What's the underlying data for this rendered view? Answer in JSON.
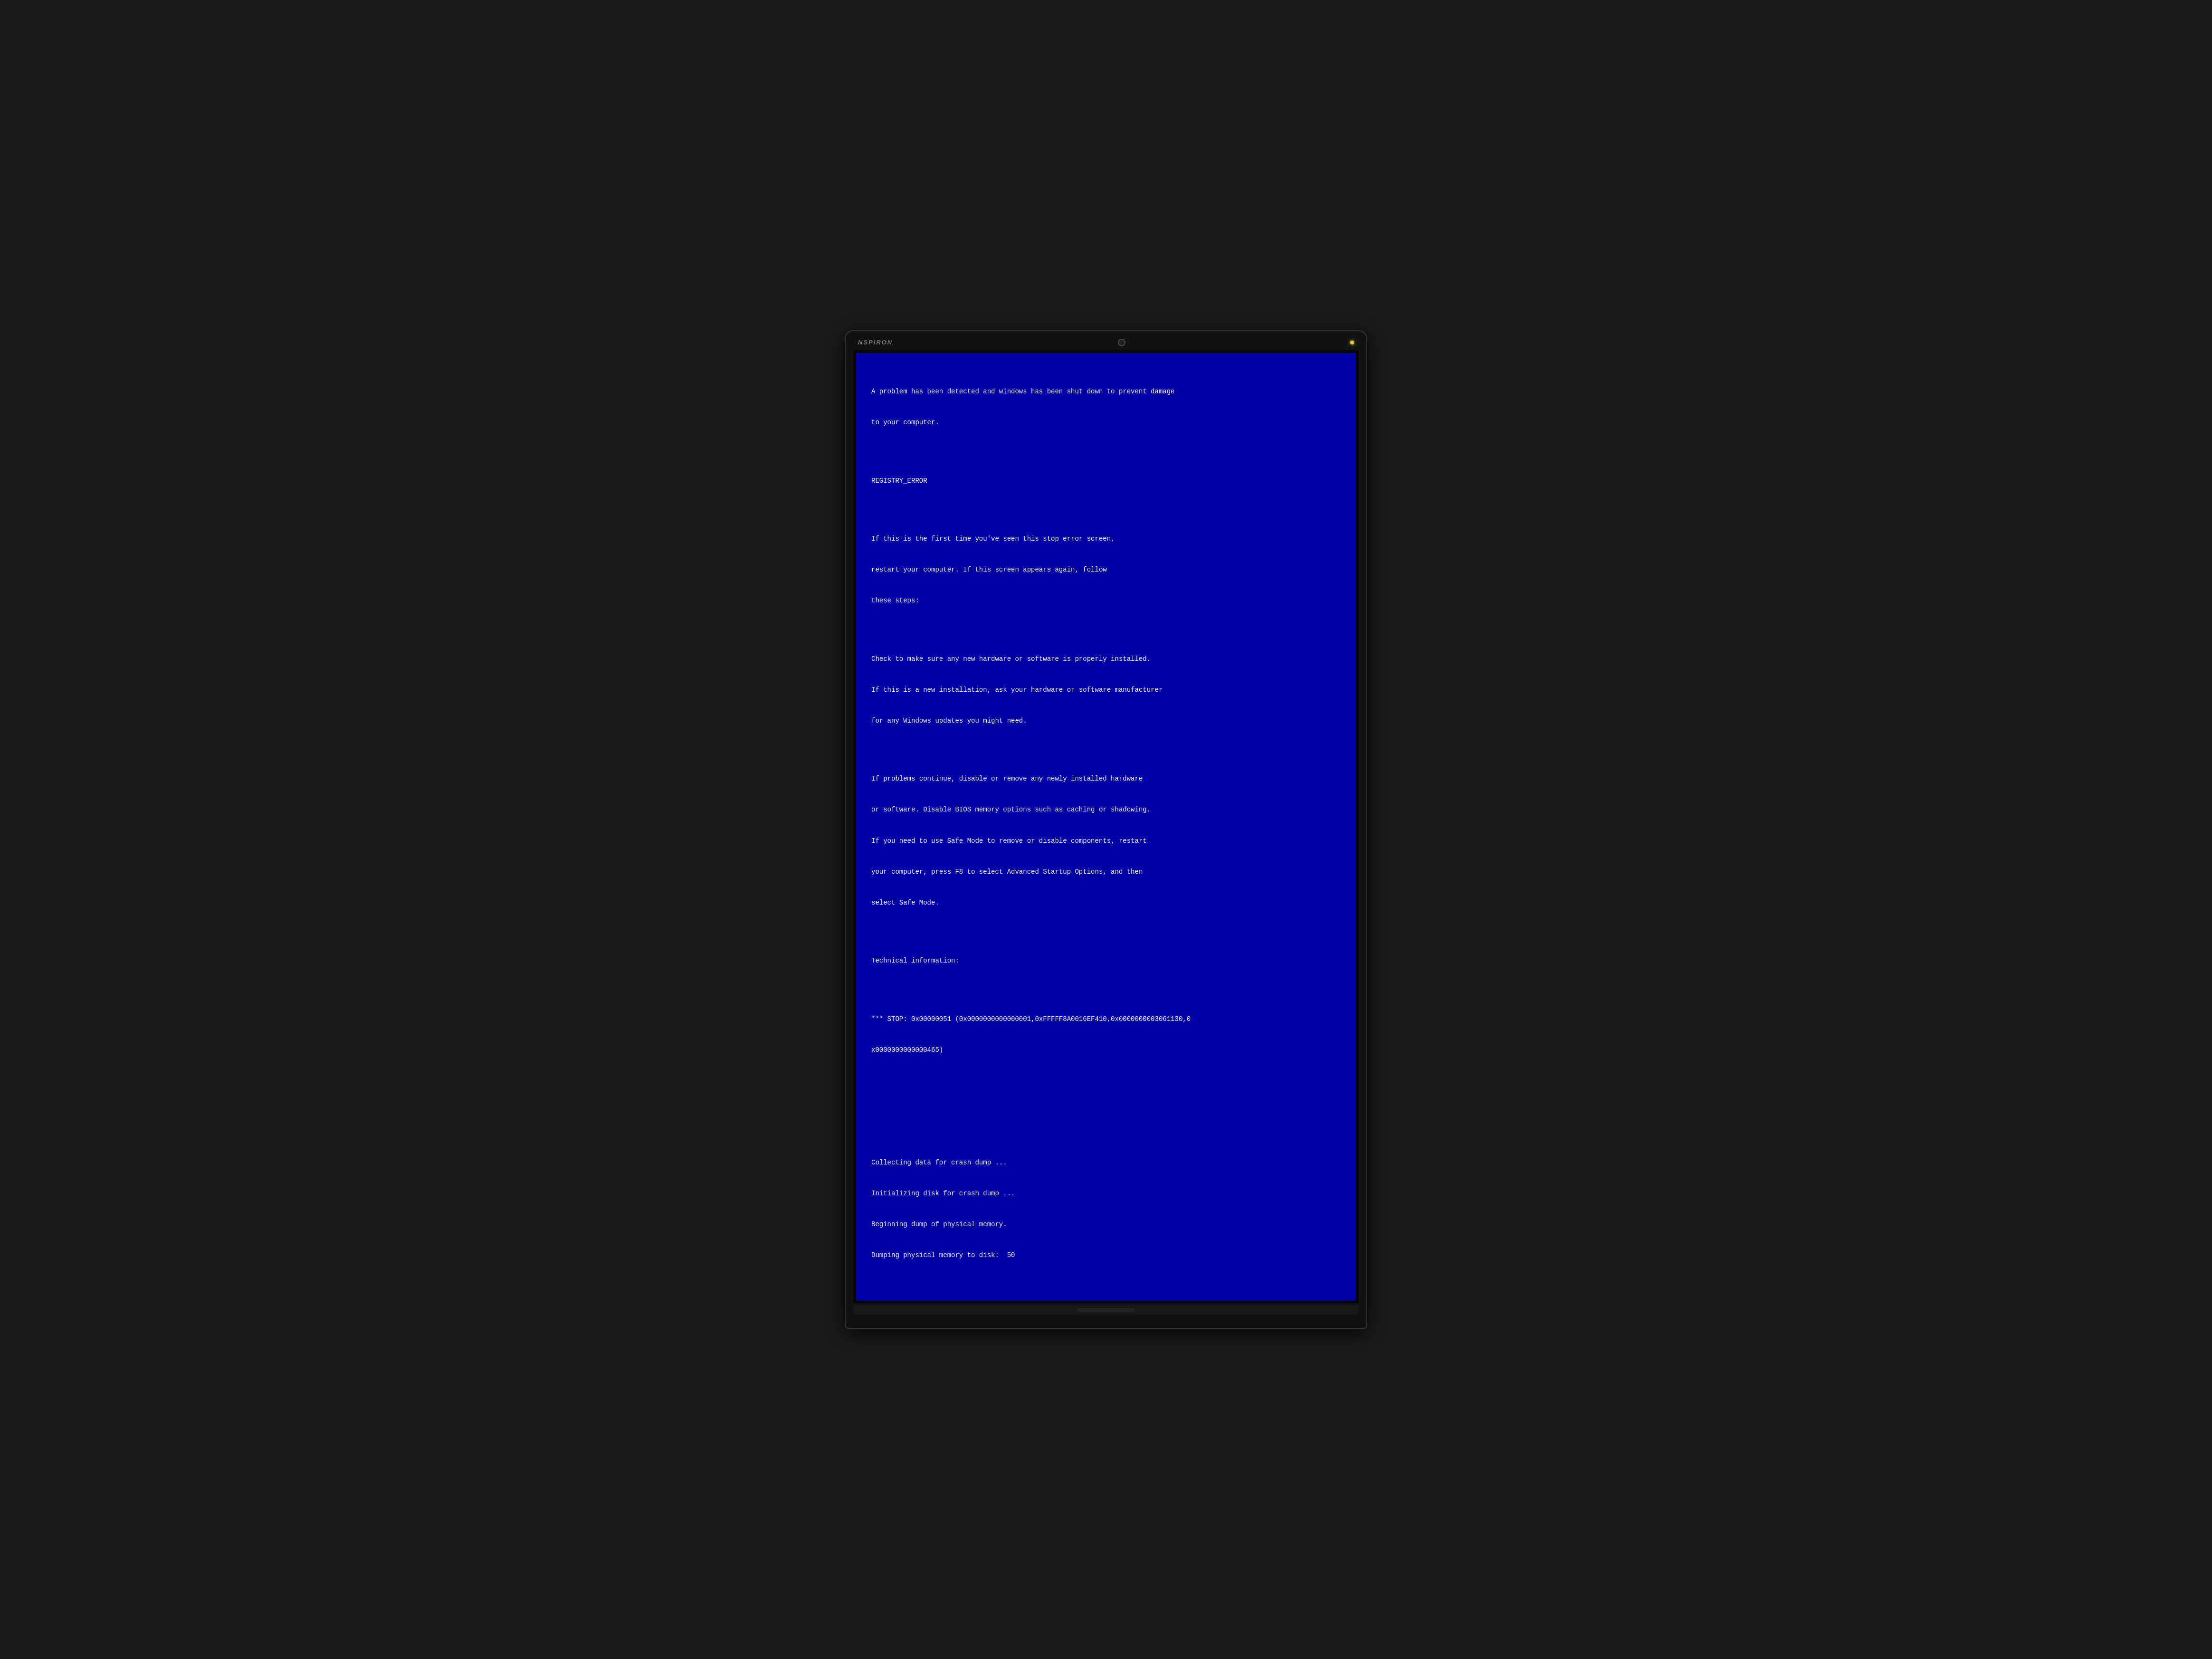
{
  "laptop": {
    "brand": "NSPIRON",
    "webcam_label": "webcam",
    "indicator_label": "power-indicator"
  },
  "bsod": {
    "line1": "A problem has been detected and windows has been shut down to prevent damage",
    "line2": "to your computer.",
    "line3": "",
    "line4": "REGISTRY_ERROR",
    "line5": "",
    "line6": "If this is the first time you've seen this stop error screen,",
    "line7": "restart your computer. If this screen appears again, follow",
    "line8": "these steps:",
    "line9": "",
    "line10": "Check to make sure any new hardware or software is properly installed.",
    "line11": "If this is a new installation, ask your hardware or software manufacturer",
    "line12": "for any Windows updates you might need.",
    "line13": "",
    "line14": "If problems continue, disable or remove any newly installed hardware",
    "line15": "or software. Disable BIOS memory options such as caching or shadowing.",
    "line16": "If you need to use Safe Mode to remove or disable components, restart",
    "line17": "your computer, press F8 to select Advanced Startup Options, and then",
    "line18": "select Safe Mode.",
    "line19": "",
    "line20": "Technical information:",
    "line21": "",
    "line22": "*** STOP: 0x00000051 (0x0000000000000001,0xFFFFF8A0016EF410,0x0000000003061130,0",
    "line23": "x0000000000000465)",
    "line24": "",
    "line25": "",
    "line26": "",
    "line27": "Collecting data for crash dump ...",
    "line28": "Initializing disk for crash dump ...",
    "line29": "Beginning dump of physical memory.",
    "line30": "Dumping physical memory to disk:  50"
  }
}
